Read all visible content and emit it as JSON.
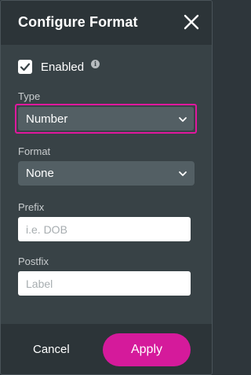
{
  "dialog": {
    "title": "Configure Format",
    "close_icon": "close-icon"
  },
  "enabled": {
    "label": "Enabled",
    "checked": true,
    "info_icon": "info-icon",
    "info_glyph": "i"
  },
  "type": {
    "label": "Type",
    "value": "Number",
    "highlight_color": "#e0189e"
  },
  "format": {
    "label": "Format",
    "value": "None"
  },
  "prefix": {
    "label": "Prefix",
    "placeholder": "i.e. DOB",
    "value": ""
  },
  "postfix": {
    "label": "Postfix",
    "placeholder": "Label",
    "value": ""
  },
  "footer": {
    "cancel_label": "Cancel",
    "apply_label": "Apply",
    "apply_color": "#d51a9b"
  }
}
